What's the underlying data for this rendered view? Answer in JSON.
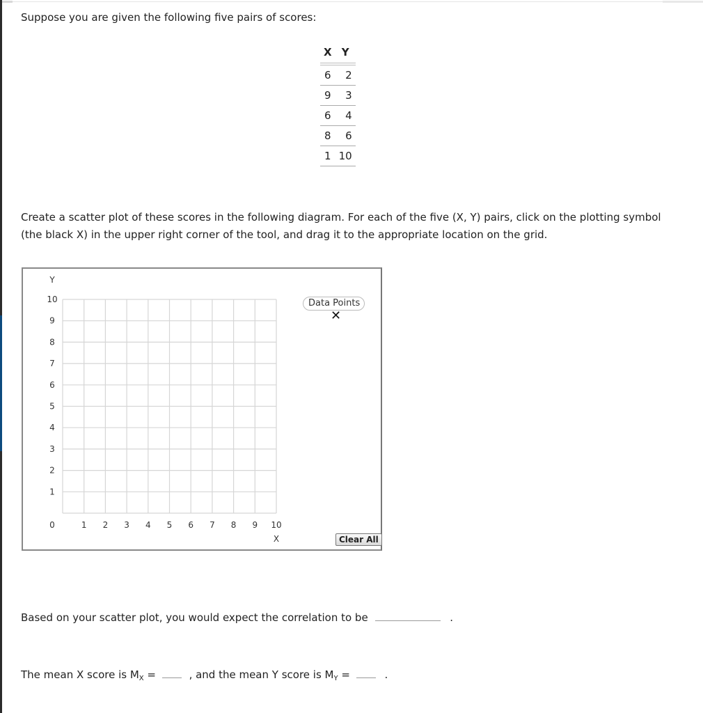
{
  "intro": "Suppose you are given the following five pairs of scores:",
  "table": {
    "headers": [
      "X",
      "Y"
    ],
    "rows": [
      {
        "x": "6",
        "y": "2"
      },
      {
        "x": "9",
        "y": "3"
      },
      {
        "x": "6",
        "y": "4"
      },
      {
        "x": "8",
        "y": "6"
      },
      {
        "x": "1",
        "y": "10"
      }
    ]
  },
  "instructions": "Create a scatter plot of these scores in the following diagram. For each of the five (X, Y) pairs, click on the plotting symbol (the black X) in the upper right corner of the tool, and drag it to the appropriate location on the grid.",
  "tool": {
    "data_points_label": "Data Points",
    "plot_symbol": "✕",
    "clear_label": "Clear All"
  },
  "chart_data": {
    "type": "scatter",
    "title": "",
    "xlabel": "X",
    "ylabel": "Y",
    "xlim": [
      0,
      10
    ],
    "ylim": [
      0,
      10
    ],
    "x_ticks": [
      "0",
      "1",
      "2",
      "3",
      "4",
      "5",
      "6",
      "7",
      "8",
      "9",
      "10"
    ],
    "y_ticks": [
      "1",
      "2",
      "3",
      "4",
      "5",
      "6",
      "7",
      "8",
      "9",
      "10"
    ],
    "grid": true,
    "points": []
  },
  "correlation": {
    "prefix": "Based on your scatter plot, you would expect the correlation to be",
    "value": "",
    "suffix": "."
  },
  "means": {
    "x_prefix": "The mean X score is M",
    "x_sub": "X",
    "equals": " =",
    "x_value": "",
    "middle": ", and the mean Y score is M",
    "y_sub": "Y",
    "y_value": "",
    "suffix": "."
  }
}
